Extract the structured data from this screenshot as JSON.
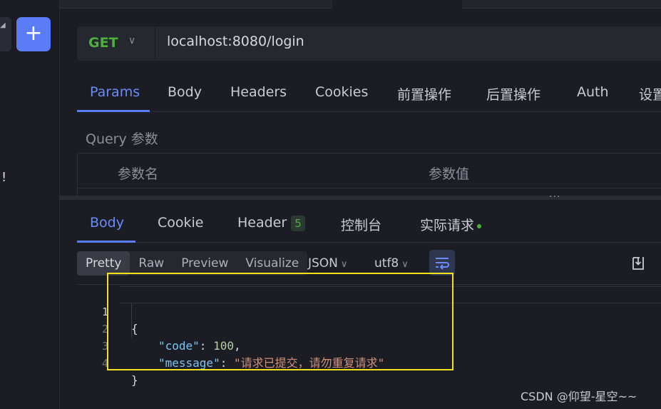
{
  "sidebar": {
    "add_label": "+",
    "mark": "!"
  },
  "request": {
    "method": "GET",
    "url": "localhost:8080/login",
    "tabs": [
      {
        "label": "Params",
        "active": true
      },
      {
        "label": "Body"
      },
      {
        "label": "Headers"
      },
      {
        "label": "Cookies"
      },
      {
        "label": "前置操作"
      },
      {
        "label": "后置操作"
      },
      {
        "label": "Auth"
      },
      {
        "label": "设置"
      }
    ],
    "query_label": "Query 参数",
    "columns": [
      "参数名",
      "参数值"
    ]
  },
  "response": {
    "tabs": [
      {
        "label": "Body",
        "active": true
      },
      {
        "label": "Cookie"
      },
      {
        "label": "Header",
        "badge": "5"
      },
      {
        "label": "控制台"
      },
      {
        "label": "实际请求",
        "dot": true
      }
    ],
    "view_modes": [
      "Pretty",
      "Raw",
      "Preview",
      "Visualize"
    ],
    "active_view": "Pretty",
    "format": "JSON",
    "encoding": "utf8",
    "code": {
      "line_numbers": [
        "1",
        "2",
        "3",
        "4"
      ],
      "open": "{",
      "code_key": "\"code\"",
      "code_value": "100",
      "message_key": "\"message\"",
      "message_value": "\"请求已提交，请勿重复请求\"",
      "close": "}"
    }
  },
  "watermark": "CSDN @仰望-星空~~",
  "colors": {
    "accent": "#5b7cf7",
    "method_get": "#4cb13a",
    "highlight": "#f5e11b"
  }
}
